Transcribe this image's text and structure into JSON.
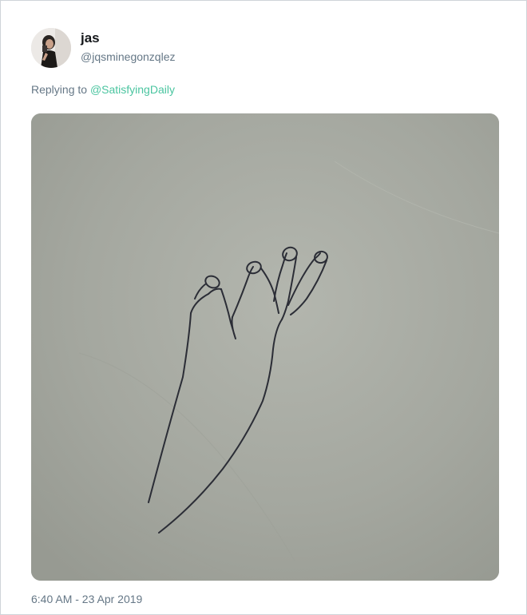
{
  "tweet": {
    "author": {
      "display_name": "jas",
      "handle": "@jqsminegonzqlez",
      "avatar_icon": "user-avatar-photo"
    },
    "reply": {
      "prefix": "Replying to",
      "mention": "@SatisfyingDaily"
    },
    "media": {
      "description_icon": "hand-drawing-photo"
    },
    "timestamp": "6:40 AM - 23 Apr 2019"
  },
  "colors": {
    "mention": "#4bc5a0",
    "secondary_text": "#657786",
    "border": "#cfd4d9"
  }
}
